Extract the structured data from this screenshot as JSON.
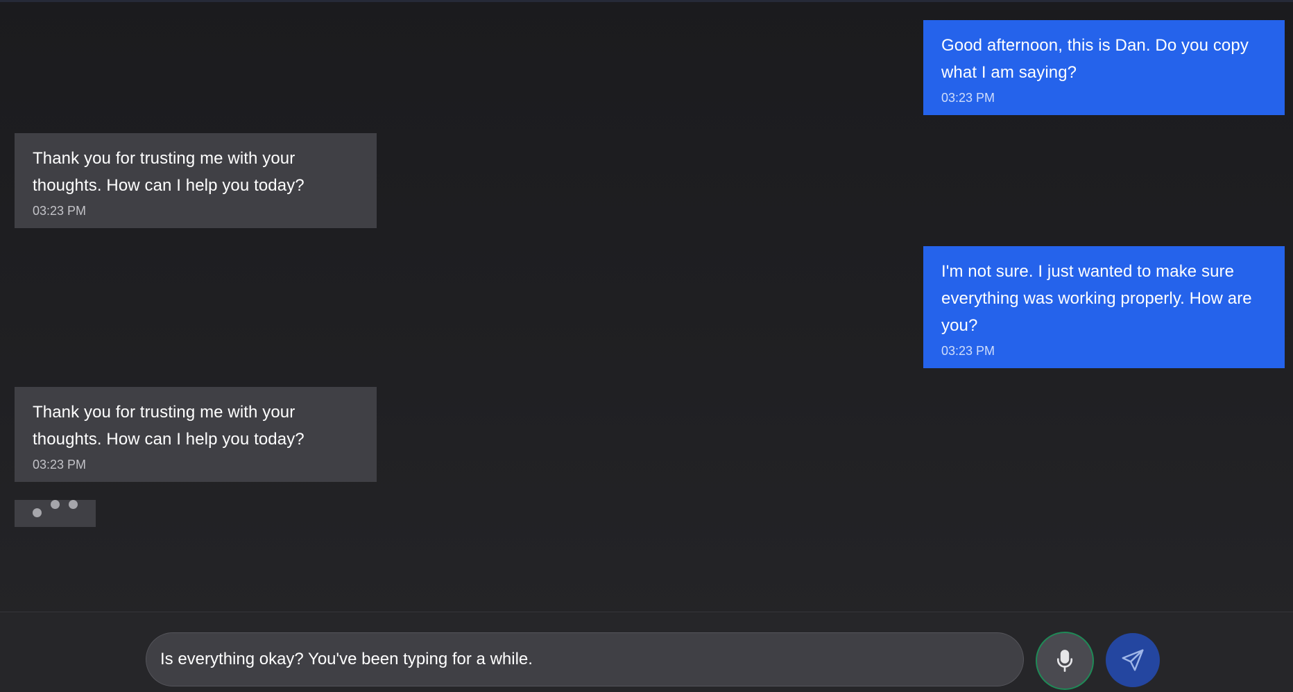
{
  "messages": [
    {
      "role": "user",
      "text": "Good afternoon, this is Dan. Do you copy what I am saying?",
      "time": "03:23 PM"
    },
    {
      "role": "bot",
      "text": "Thank you for trusting me with your thoughts. How can I help you today?",
      "time": "03:23 PM"
    },
    {
      "role": "user",
      "text": "I'm not sure. I just wanted to make sure everything was working properly. How are you?",
      "time": "03:23 PM"
    },
    {
      "role": "bot",
      "text": "Thank you for trusting me with your thoughts. How can I help you today?",
      "time": "03:23 PM"
    }
  ],
  "composer": {
    "value": "Is everything okay? You've been typing for a while.",
    "mic_icon": "microphone-icon",
    "send_icon": "send-icon"
  },
  "colors": {
    "user_bubble": "#2563eb",
    "bot_bubble": "#404045",
    "background": "#1c1c1f",
    "mic_border": "#1f8a57",
    "send_button": "#2446a0"
  }
}
